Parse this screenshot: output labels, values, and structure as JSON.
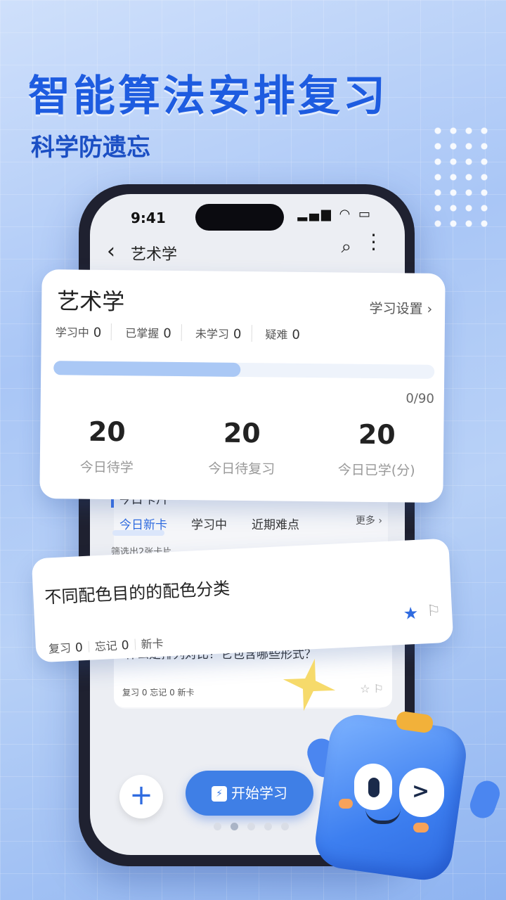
{
  "headline": "智能算法安排复习",
  "subline": "科学防遗忘",
  "phone": {
    "status_time": "9:41",
    "nav": {
      "title": "艺术学"
    },
    "section_label": "今日卡片",
    "tabs": [
      {
        "label": "今日新卡",
        "active": true
      },
      {
        "label": "学习中",
        "active": false
      },
      {
        "label": "近期难点",
        "active": false
      }
    ],
    "more": "更多 ›",
    "filter_note": "筛选出2张卡片",
    "second_card": {
      "question": "什么是排列对比？它包含哪些形式？",
      "stats": "复习 0  忘记 0  新卡"
    },
    "start_button": "开始学习"
  },
  "summary": {
    "title": "艺术学",
    "settings": "学习设置 ›",
    "stats": [
      {
        "label": "学习中",
        "value": "0"
      },
      {
        "label": "已掌握",
        "value": "0"
      },
      {
        "label": "未学习",
        "value": "0"
      },
      {
        "label": "疑难",
        "value": "0"
      }
    ],
    "progress_count": "0/90",
    "progress_fill": 0.49,
    "metrics": [
      {
        "value": "20",
        "label": "今日待学"
      },
      {
        "value": "20",
        "label": "今日待复习"
      },
      {
        "value": "20",
        "label": "今日已学(分)"
      }
    ]
  },
  "card": {
    "title": "不同配色目的的配色分类",
    "review_label": "复习",
    "review_value": "0",
    "forget_label": "忘记",
    "forget_value": "0",
    "tag": "新卡"
  },
  "colors": {
    "accent": "#2f6be0",
    "headline": "#1e5ce0"
  }
}
